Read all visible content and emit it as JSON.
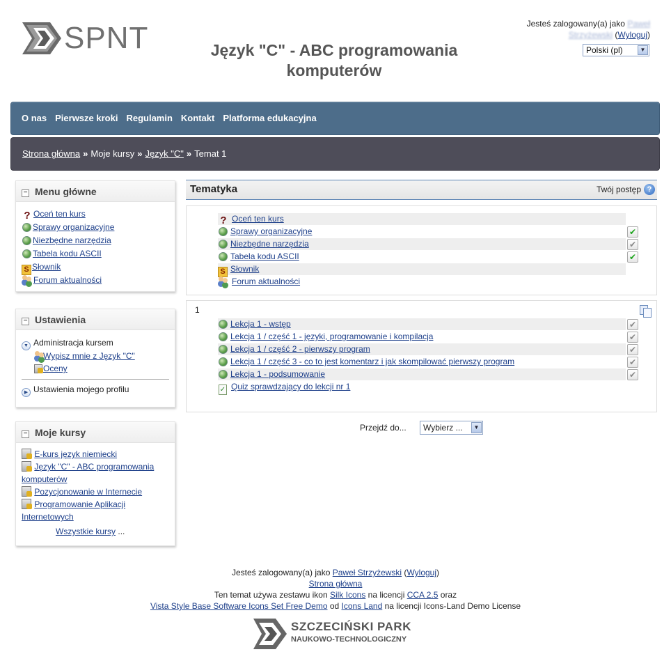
{
  "header": {
    "logo_text": "SPNT",
    "site_title_line1": "Język \"C\" - ABC programowania",
    "site_title_line2": "komputerów",
    "logged_in_prefix": "Jesteś zalogowany(a) jako",
    "user_name_line1": "Paweł",
    "user_name_line2": "Strzyżewski",
    "logout_label": "Wyloguj",
    "language": "Polski (pl)"
  },
  "nav": {
    "items": [
      "O nas",
      "Pierwsze kroki",
      "Regulamin",
      "Kontakt",
      "Platforma edukacyjna"
    ]
  },
  "breadcrumb": {
    "home": "Strona główna",
    "my_courses": "Moje kursy",
    "course": "Język \"C\"",
    "current": "Temat 1"
  },
  "menu_block": {
    "title": "Menu główne",
    "items": [
      "Oceń ten kurs",
      "Sprawy organizacyjne",
      "Niezbędne narzędzia",
      "Tabela kodu ASCII",
      "Słownik",
      "Forum aktualności"
    ]
  },
  "settings_block": {
    "title": "Ustawienia",
    "admin_label": "Administracja kursem",
    "unenrol_label": "Wypisz mnie z Język \"C\"",
    "grades_label": "Oceny",
    "profile_label": "Ustawienia mojego profilu"
  },
  "courses_block": {
    "title": "Moje kursy",
    "items": [
      {
        "line1": "E-kurs język niemiecki"
      },
      {
        "line1": "Język \"C\" - ABC programowania",
        "line2": "komputerów"
      },
      {
        "line1": "Pozycjonowanie w Internecie"
      },
      {
        "line1": "Programowanie Aplikacji",
        "line2": "Internetowych"
      }
    ],
    "all_courses": "Wszystkie kursy",
    "ellipsis": "..."
  },
  "main": {
    "heading": "Tematyka",
    "progress_label": "Twój postęp",
    "help_glyph": "?",
    "section0": [
      {
        "label": "Oceń ten kurs",
        "icon": "question-icon",
        "check": "none"
      },
      {
        "label": "Sprawy organizacyjne",
        "icon": "globe-icon",
        "check": "done"
      },
      {
        "label": "Niezbędne narzędzia",
        "icon": "globe-icon",
        "check": "todo"
      },
      {
        "label": "Tabela kodu ASCII",
        "icon": "globe-icon",
        "check": "done"
      },
      {
        "label": "Słownik",
        "icon": "glossary-icon",
        "check": "none"
      },
      {
        "label": "Forum aktualności",
        "icon": "forum-icon",
        "check": "none"
      }
    ],
    "section1_number": "1",
    "section1": [
      {
        "label": "Lekcja 1 - wstęp",
        "icon": "globe-icon",
        "check": "todo"
      },
      {
        "label": "Lekcja 1 / część 1 - języki, programowanie i kompilacja",
        "icon": "globe-icon",
        "check": "todo"
      },
      {
        "label": "Lekcja 1 / część 2 - pierwszy program",
        "icon": "globe-icon",
        "check": "todo"
      },
      {
        "label": "Lekcja 1 / część 3 - co to jest komentarz i jak skompilować pierwszy program",
        "icon": "globe-icon",
        "check": "todo"
      },
      {
        "label": "Lekcja 1 - podsumowanie",
        "icon": "globe-icon",
        "check": "todo"
      },
      {
        "label": "Quiz sprawdzający do lekcji nr 1",
        "icon": "quiz-icon",
        "check": "none"
      }
    ],
    "jump_label": "Przejdź do...",
    "jump_value": "Wybierz ..."
  },
  "footer": {
    "logged_in_prefix": "Jesteś zalogowany(a) jako",
    "user_name": "Paweł Strzyżewski",
    "logout_label": "Wyloguj",
    "home_link": "Strona główna",
    "theme_text_1": "Ten temat używa zestawu ikon",
    "silk_icons": "Silk Icons",
    "on_license": "na licencji",
    "cca": "CCA 2.5",
    "and": "oraz",
    "vista_link": "Vista Style Base Software Icons Set Free Demo",
    "from": "od",
    "icons_land": "Icons Land",
    "license_end": "na licencji Icons-Land Demo License",
    "logo_line1": "SZCZECIŃSKI PARK",
    "logo_line2": "NAUKOWO-TECHNOLOGICZNY"
  },
  "colors": {
    "nav_bg": "#4d6d8a",
    "crumb_bg": "#4e4d59",
    "link": "#1d3f8a",
    "check_done": "#19a319"
  }
}
